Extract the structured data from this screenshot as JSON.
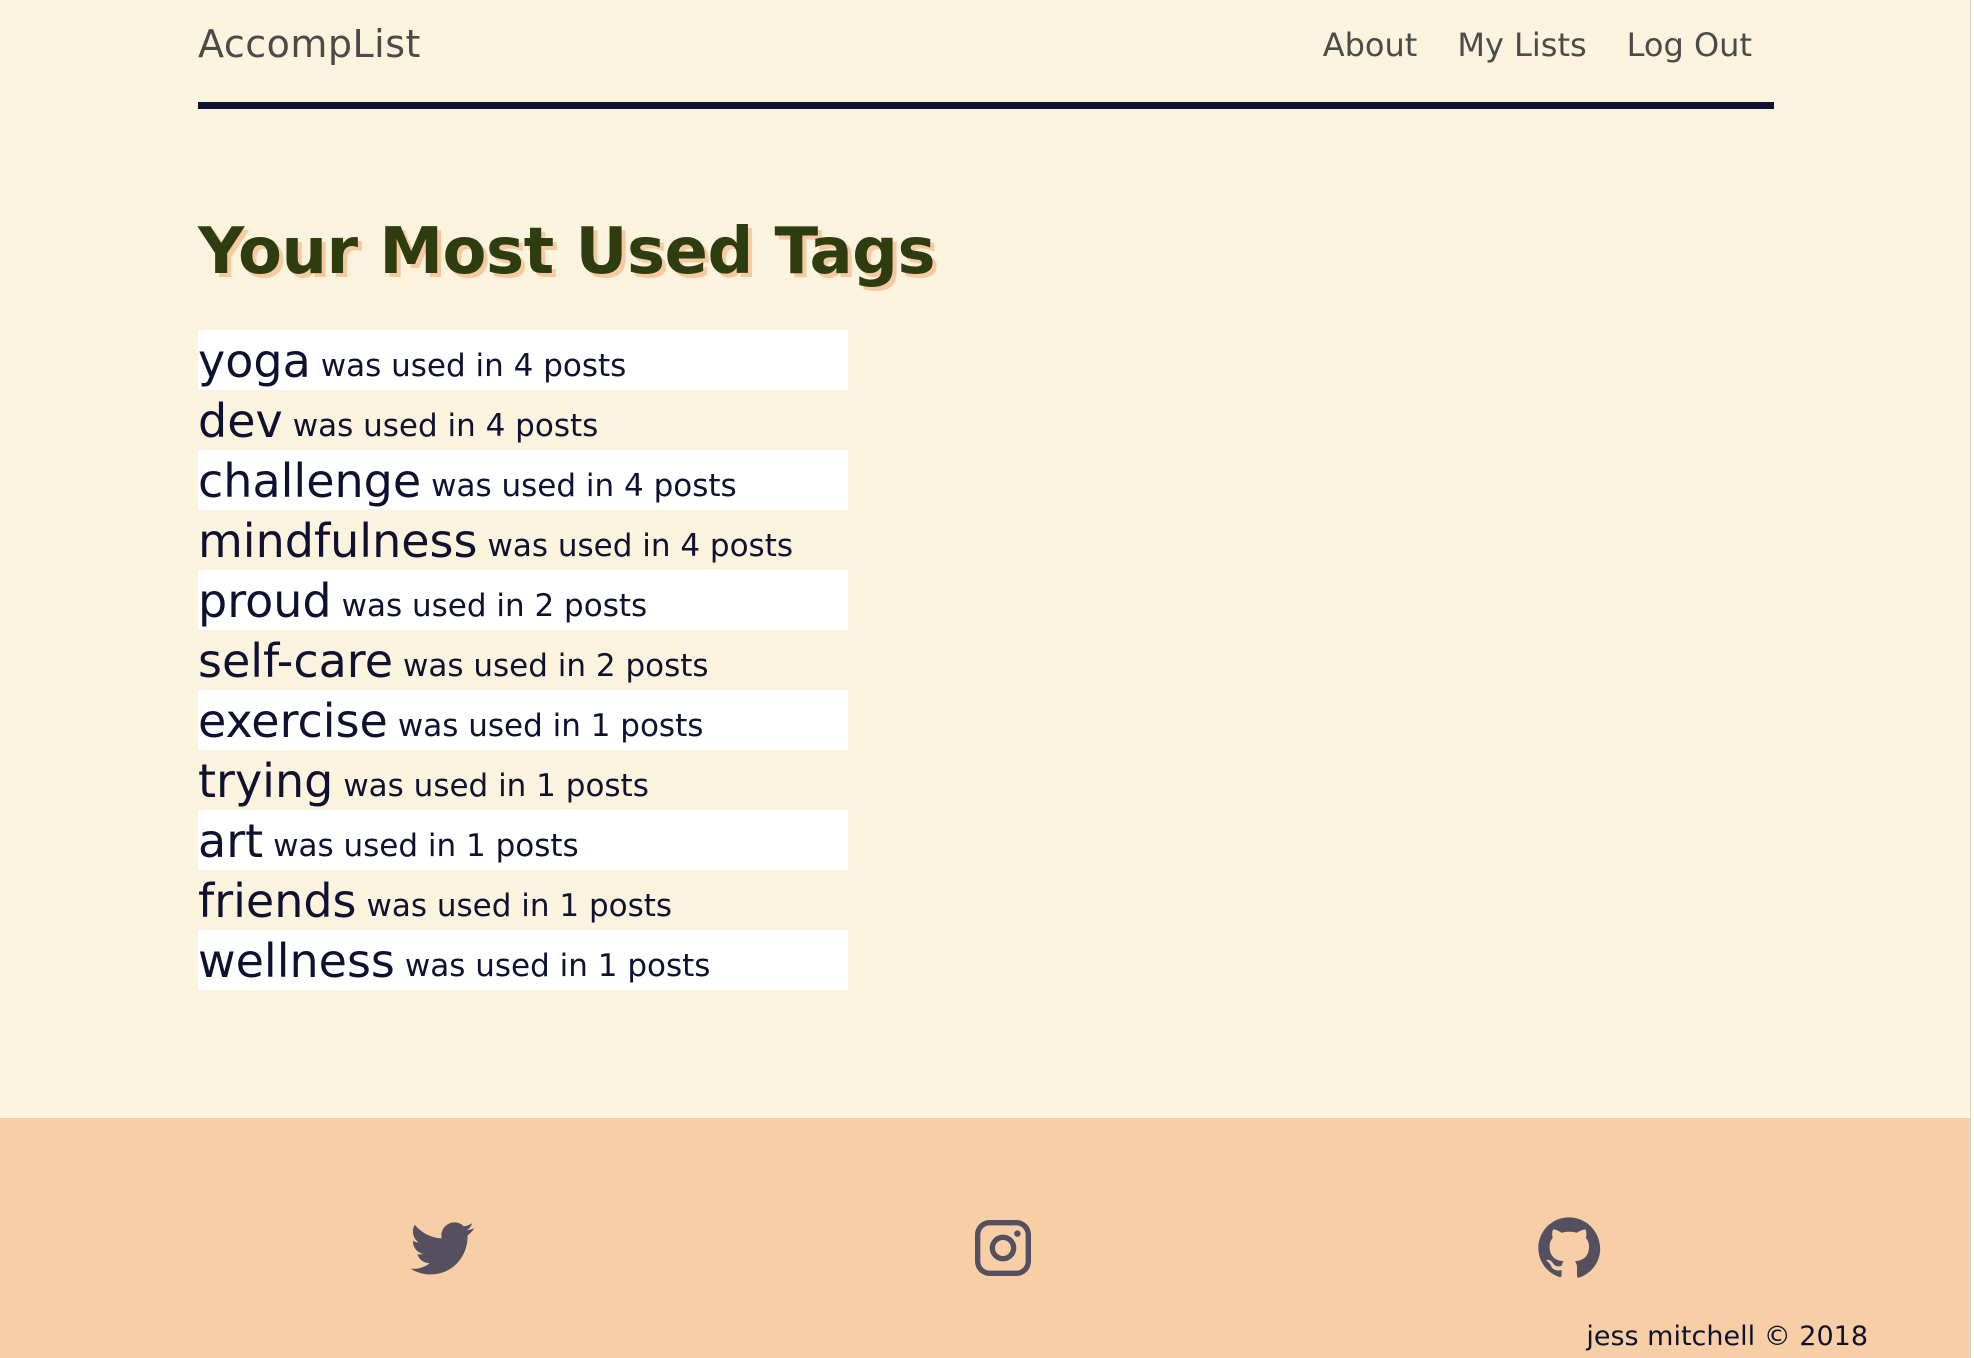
{
  "header": {
    "brand": "AccompList",
    "nav": {
      "about": "About",
      "my_lists": "My Lists",
      "log_out": "Log Out"
    }
  },
  "main": {
    "title": "Your Most Used Tags",
    "tags": [
      {
        "name": "yoga",
        "count_text": "was used in 4 posts"
      },
      {
        "name": "dev",
        "count_text": "was used in 4 posts"
      },
      {
        "name": "challenge",
        "count_text": "was used in 4 posts"
      },
      {
        "name": "mindfulness",
        "count_text": "was used in 4 posts"
      },
      {
        "name": "proud",
        "count_text": "was used in 2 posts"
      },
      {
        "name": "self-care",
        "count_text": "was used in 2 posts"
      },
      {
        "name": "exercise",
        "count_text": "was used in 1 posts"
      },
      {
        "name": "trying",
        "count_text": "was used in 1 posts"
      },
      {
        "name": "art",
        "count_text": "was used in 1 posts"
      },
      {
        "name": "friends",
        "count_text": "was used in 1 posts"
      },
      {
        "name": "wellness",
        "count_text": "was used in 1 posts"
      }
    ]
  },
  "footer": {
    "icons": [
      "twitter-icon",
      "instagram-icon",
      "github-icon"
    ],
    "copyright": "jess mitchell © 2018"
  },
  "colors": {
    "background": "#fcf3df",
    "footer": "#f8cea6",
    "title": "#2e3d0f",
    "title_shadow": "#f7c9a0",
    "text": "#0e1230"
  }
}
